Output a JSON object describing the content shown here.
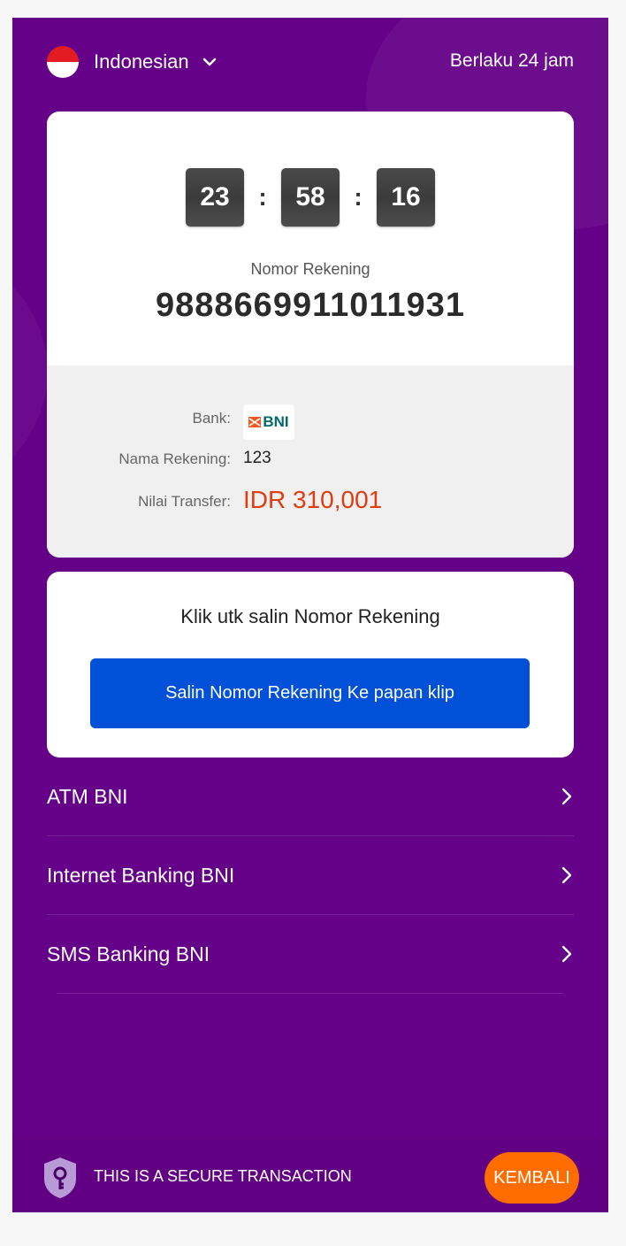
{
  "header": {
    "language": "Indonesian",
    "validity": "Berlaku 24 jam"
  },
  "timer": {
    "hours": "23",
    "minutes": "58",
    "seconds": "16",
    "separator": ":"
  },
  "account": {
    "label": "Nomor Rekening",
    "number": "9888669911011931"
  },
  "details": {
    "bank_label": "Bank:",
    "bank_logo_text": "BNI",
    "name_label": "Nama Rekening:",
    "name_value": "123",
    "amount_label": "Nilai Transfer:",
    "amount_value": "IDR 310,001"
  },
  "copy": {
    "title": "Klik utk salin Nomor Rekening",
    "button_label": "Salin Nomor Rekening Ke papan klip"
  },
  "guides": [
    {
      "label": "ATM BNI"
    },
    {
      "label": "Internet Banking BNI"
    },
    {
      "label": "SMS Banking BNI"
    }
  ],
  "footer": {
    "secure_text": "THIS IS A SECURE TRANSACTION",
    "back_label": "KEMBALI"
  },
  "colors": {
    "background": "#650088",
    "button_blue": "#0050d8",
    "amount": "#e03c0e",
    "back_button": "#ff6c00"
  }
}
